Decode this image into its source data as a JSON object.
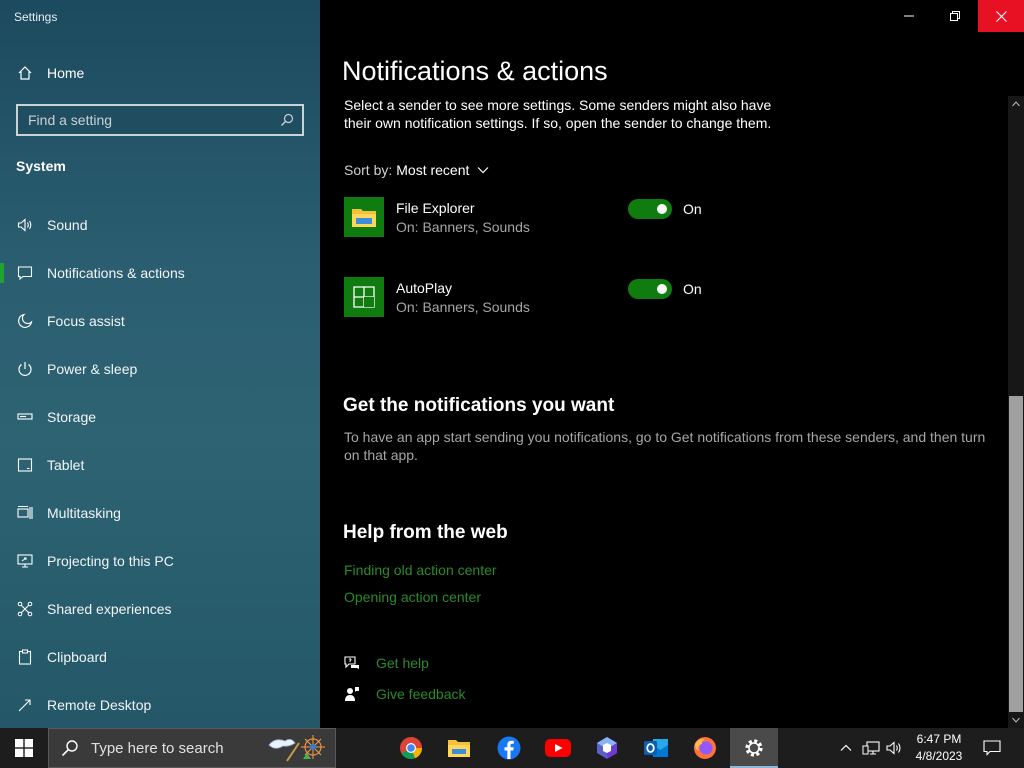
{
  "window": {
    "title": "Settings",
    "minimize_icon": "minimize-icon",
    "restore_icon": "restore-icon",
    "close_icon": "close-icon",
    "close_color": "#e81123"
  },
  "sidebar": {
    "home_label": "Home",
    "search_placeholder": "Find a setting",
    "section_title": "System",
    "items": [
      {
        "label": "Sound",
        "icon": "speaker-icon"
      },
      {
        "label": "Notifications & actions",
        "icon": "notification-icon",
        "active": true
      },
      {
        "label": "Focus assist",
        "icon": "moon-icon"
      },
      {
        "label": "Power & sleep",
        "icon": "power-icon"
      },
      {
        "label": "Storage",
        "icon": "storage-icon"
      },
      {
        "label": "Tablet",
        "icon": "tablet-icon"
      },
      {
        "label": "Multitasking",
        "icon": "multitasking-icon"
      },
      {
        "label": "Projecting to this PC",
        "icon": "projecting-icon"
      },
      {
        "label": "Shared experiences",
        "icon": "shared-icon"
      },
      {
        "label": "Clipboard",
        "icon": "clipboard-icon"
      },
      {
        "label": "Remote Desktop",
        "icon": "remote-desktop-icon"
      }
    ]
  },
  "main": {
    "title": "Notifications & actions",
    "intro": "Select a sender to see more settings. Some senders might also have their own notification settings. If so, open the sender to change them.",
    "sort_label": "Sort by:",
    "sort_value": "Most recent",
    "senders": [
      {
        "name": "File Explorer",
        "status": "On: Banners, Sounds",
        "toggle_label": "On",
        "enabled": true,
        "icon": "file-explorer-icon"
      },
      {
        "name": "AutoPlay",
        "status": "On: Banners, Sounds",
        "toggle_label": "On",
        "enabled": true,
        "icon": "autoplay-icon"
      }
    ],
    "get_notifications_heading": "Get the notifications you want",
    "get_notifications_text": "To have an app start sending you notifications, go to Get notifications from these senders, and then turn on that app.",
    "help_heading": "Help from the web",
    "help_links": [
      "Finding old action center",
      "Opening action center"
    ],
    "get_help": "Get help",
    "give_feedback": "Give feedback",
    "accent_color": "#107c10",
    "link_color": "#2b8a2b"
  },
  "taskbar": {
    "search_placeholder": "Type here to search",
    "apps": [
      "chrome-icon",
      "file-explorer-icon",
      "facebook-icon",
      "youtube-icon",
      "copilot-icon",
      "outlook-icon",
      "firefox-icon",
      "settings-icon"
    ],
    "time": "6:47 PM",
    "date": "4/8/2023"
  }
}
